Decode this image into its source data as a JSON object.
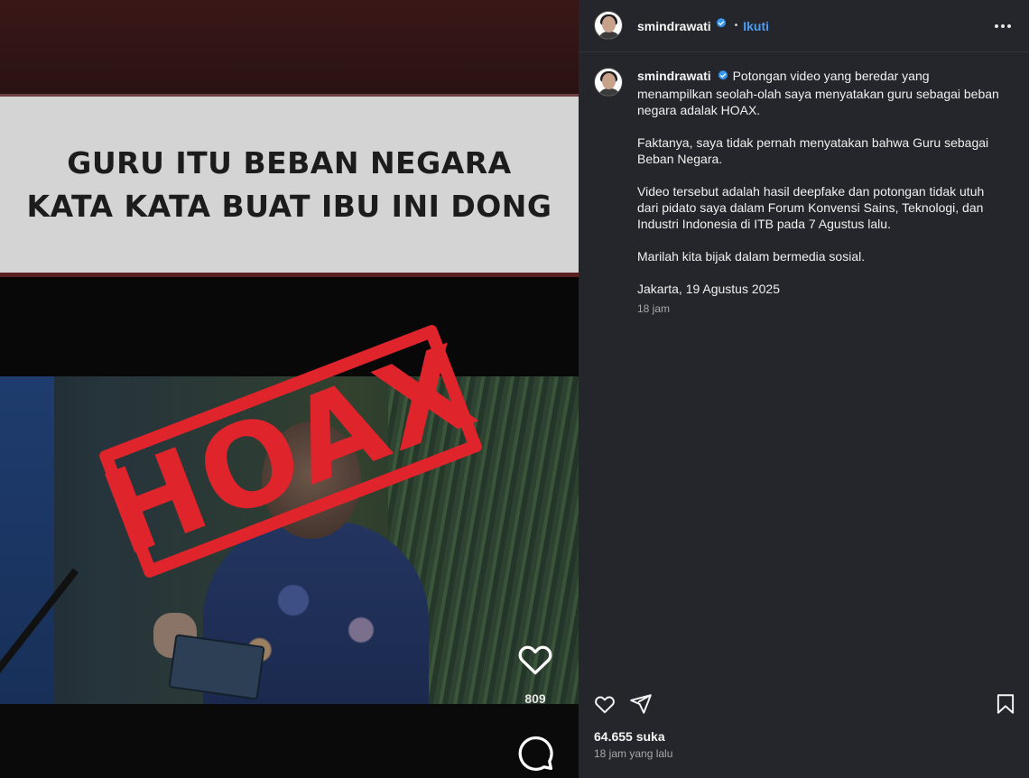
{
  "media": {
    "banner_line_1": "GURU ITU BEBAN NEGARA",
    "banner_line_2": "KATA KATA BUAT IBU INI DONG",
    "stamp_text": "HOAX",
    "stamp_color": "#e0242c",
    "reel_like_count": "809",
    "icons": [
      "heart-icon",
      "comment-icon"
    ]
  },
  "header": {
    "username": "smindrawati",
    "verified": true,
    "dot": "•",
    "follow_label": "Ikuti",
    "more_icon": "more-horizontal-icon"
  },
  "caption": {
    "username": "smindrawati",
    "paragraphs": [
      "Potongan video yang beredar yang menampilkan seolah-olah saya menyatakan guru sebagai beban negara adalak HOAX.",
      "Faktanya, saya tidak pernah menyatakan bahwa Guru sebagai Beban Negara.",
      "Video tersebut adalah hasil deepfake dan potongan tidak utuh dari pidato saya dalam Forum Konvensi Sains, Teknologi, dan Industri Indonesia di ITB pada 7 Agustus lalu.",
      "Marilah kita bijak dalam bermedia sosial.",
      "Jakarta, 19 Agustus 2025"
    ],
    "time": "18 jam"
  },
  "footer": {
    "likes": "64.655 suka",
    "posted_ago": "18 jam yang lalu",
    "icons": [
      "heart-icon",
      "share-icon",
      "bookmark-icon"
    ]
  },
  "colors": {
    "panel_bg": "#25262b",
    "accent": "#4a9cf5",
    "verified": "#3897f0"
  }
}
